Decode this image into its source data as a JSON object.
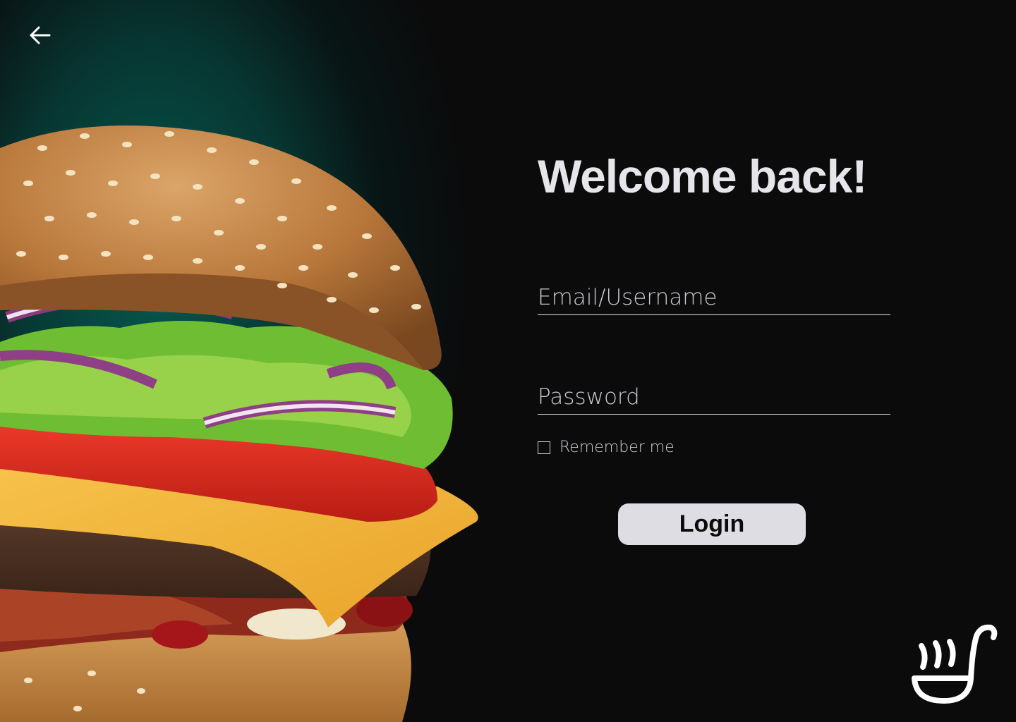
{
  "nav": {
    "back_icon": "arrow-left-icon"
  },
  "hero": {
    "image": "burger-illustration"
  },
  "login": {
    "title": "Welcome back!",
    "email_placeholder": "Email/Username",
    "email_value": "",
    "password_placeholder": "Password",
    "password_value": "",
    "remember_label": "Remember me",
    "remember_checked": false,
    "submit_label": "Login"
  },
  "brand": {
    "logo_icon": "ladle-soup-logo-icon"
  },
  "colors": {
    "background": "#0b0b0c",
    "glow": "#065c52",
    "text": "#e6e6ea",
    "button_bg": "#dddde3",
    "button_text": "#0b0b0c"
  }
}
